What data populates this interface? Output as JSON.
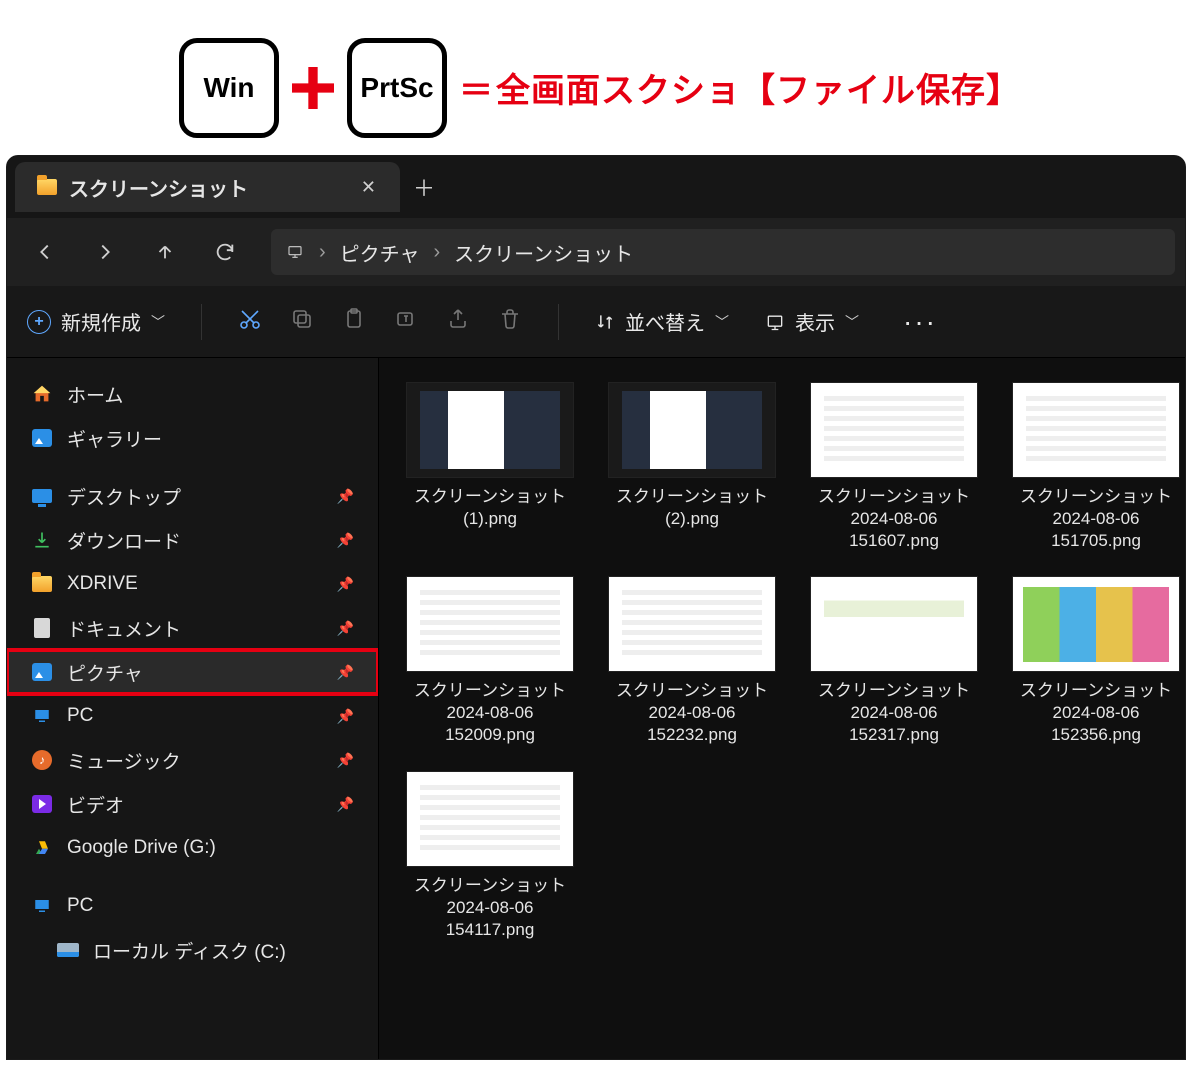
{
  "shortcut": {
    "key1": "Win",
    "key2": "PrtSc",
    "equals": "＝",
    "description": "全画面スクショ【ファイル保存】"
  },
  "tab": {
    "title": "スクリーンショット"
  },
  "breadcrumb": {
    "items": [
      "ピクチャ",
      "スクリーンショット"
    ]
  },
  "toolbar": {
    "new_label": "新規作成",
    "sort_label": "並べ替え",
    "view_label": "表示"
  },
  "sidebar": {
    "home": "ホーム",
    "gallery": "ギャラリー",
    "desktop": "デスクトップ",
    "downloads": "ダウンロード",
    "xdrive": "XDRIVE",
    "documents": "ドキュメント",
    "pictures": "ピクチャ",
    "pc": "PC",
    "music": "ミュージック",
    "video": "ビデオ",
    "gdrive": "Google Drive (G:)",
    "pc2": "PC",
    "localdisk": "ローカル ディスク (C:)"
  },
  "files": [
    {
      "name": "スクリーンショット\n(1).png",
      "style": "dark"
    },
    {
      "name": "スクリーンショット\n(2).png",
      "style": "dark"
    },
    {
      "name": "スクリーンショット\n2024-08-06\n151607.png",
      "style": "doc"
    },
    {
      "name": "スクリーンショット\n2024-08-06\n151705.png",
      "style": "doc"
    },
    {
      "name": "スクリーンショット\n2024-08-06\n152009.png",
      "style": "doc"
    },
    {
      "name": "スクリーンショット\n2024-08-06\n152232.png",
      "style": "doc"
    },
    {
      "name": "スクリーンショット\n2024-08-06\n152317.png",
      "style": "web"
    },
    {
      "name": "スクリーンショット\n2024-08-06\n152356.png",
      "style": "photo"
    },
    {
      "name": "スクリーンショット\n2024-08-06\n154117.png",
      "style": "doc"
    }
  ]
}
